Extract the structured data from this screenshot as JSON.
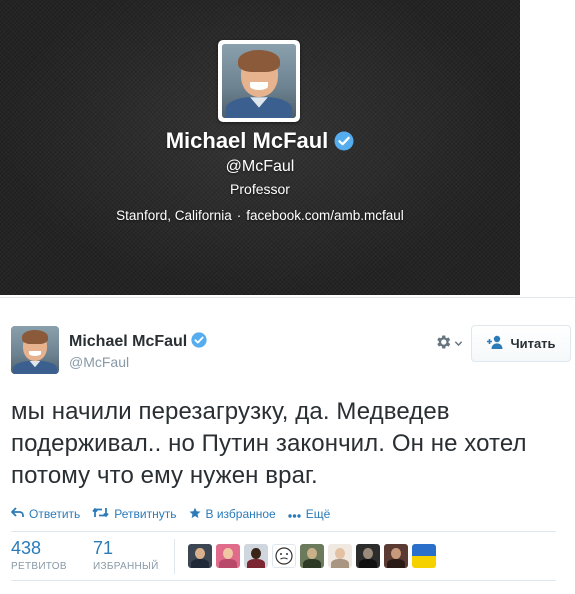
{
  "profile": {
    "name": "Michael McFaul",
    "handle": "@McFaul",
    "bio": "Professor",
    "location": "Stanford, California",
    "separator": "·",
    "website": "facebook.com/amb.mcfaul",
    "verified_icon": "verified-badge-icon",
    "background_color": "#242424"
  },
  "tweet": {
    "author_name": "Michael McFaul",
    "author_handle": "@McFaul",
    "follow_label": "Читать",
    "gear_icon": "gear-icon",
    "text": "мы начили перезагрузку, да. Медведев подерживал.. но Путин закончил. Он не хотел потому что ему нужен враг."
  },
  "actions": {
    "reply": "Ответить",
    "retweet": "Ретвитнуть",
    "favorite": "В избранное",
    "more": "Ещё"
  },
  "stats": {
    "retweets_count": "438",
    "retweets_label": "РЕТВИТОВ",
    "favorites_count": "71",
    "favorites_label": "ИЗБРАННЫЙ"
  },
  "colors": {
    "link_blue": "#2b7bb9",
    "verified_blue": "#55acee",
    "muted_gray": "#8899a6",
    "text_dark": "#292f33"
  }
}
